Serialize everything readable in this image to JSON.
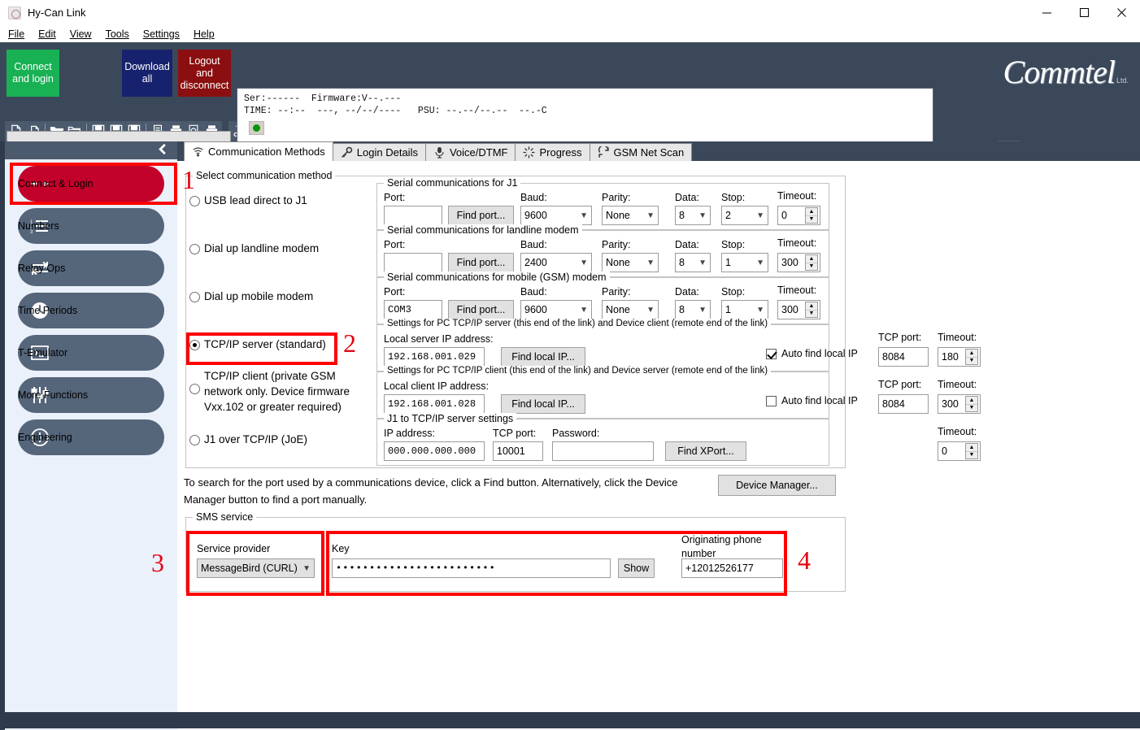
{
  "window": {
    "title": "Hy-Can Link",
    "minimize": "—",
    "maximize": "□",
    "close": "✕"
  },
  "menu": [
    {
      "label": "File"
    },
    {
      "label": "Edit"
    },
    {
      "label": "View"
    },
    {
      "label": "Tools"
    },
    {
      "label": "Settings"
    },
    {
      "label": "Help"
    }
  ],
  "header": {
    "connect_button": "Connect and login",
    "download_button": "Download all",
    "logout_button": "Logout and disconnect",
    "status_line1": "Ser:------  Firmware:V--.---",
    "status_line2": "TIME: --:--  ---, --/--/----   PSU: --.--/--.--  --.-C",
    "led_state": "green",
    "logo_text": "Commtel",
    "logo_sub": "Ltd.",
    "social": [
      "apple-icon",
      "android-icon",
      "facebook-icon",
      "youtube-icon"
    ]
  },
  "toolbar": {
    "groups": [
      [
        "new-file-icon",
        "copy-file-icon",
        "sep",
        "open-folder-icon",
        "open-folder-alt-icon",
        "sep",
        "save-icon",
        "save-as-icon",
        "save-all-icon",
        "sep",
        "document-icon",
        "print-preview-icon",
        "find-document-icon",
        "print-icon"
      ],
      [
        "cut-icon",
        "copy-icon",
        "paste-icon",
        "sep",
        "zoom-icon"
      ],
      [
        "wifi-icon",
        "key-icon",
        "microphone-icon",
        "progress-icon",
        "refresh-icon",
        "edit-pen-icon",
        "sep",
        "monitor-icon",
        "monitor-back-icon",
        "sep",
        "network-icon",
        "sep",
        "clock-icon",
        "calendar-icon",
        "download-icon",
        "sep",
        "terminal-icon",
        "sep",
        "relay-icon",
        "sliders-icon",
        "sep",
        "list-icon",
        "record-icon",
        "filter-icon",
        "speaker-icon",
        "lightning-icon",
        "card-icon",
        "chart-icon"
      ]
    ]
  },
  "sidebar": {
    "collapse_icon": "chevron-left-icon",
    "items": [
      {
        "label": "Connect & Login",
        "icon": "connect-arrows-icon",
        "active": true
      },
      {
        "label": "Numbers",
        "icon": "numbered-list-icon",
        "active": false
      },
      {
        "label": "Relay Ops",
        "icon": "relay-arrows-icon",
        "active": false
      },
      {
        "label": "Time Periods",
        "icon": "clock-icon",
        "active": false
      },
      {
        "label": "T-Emulator",
        "icon": "terminal-icon",
        "active": false
      },
      {
        "label": "More Functions",
        "icon": "sliders-icon",
        "active": false
      },
      {
        "label": "Engineering",
        "icon": "exclamation-circle-icon",
        "active": false
      }
    ]
  },
  "tabs": [
    {
      "label": "Communication Methods",
      "icon": "wifi-icon",
      "active": true
    },
    {
      "label": "Login Details",
      "icon": "key-icon",
      "active": false
    },
    {
      "label": "Voice/DTMF",
      "icon": "microphone-icon",
      "active": false
    },
    {
      "label": "Progress",
      "icon": "progress-icon",
      "active": false
    },
    {
      "label": "GSM Net Scan",
      "icon": "refresh-icon",
      "active": false
    }
  ],
  "main": {
    "select_method_legend": "Select communication method",
    "methods": [
      {
        "label": "USB lead direct to J1",
        "checked": false
      },
      {
        "label": "Dial up landline modem",
        "checked": false
      },
      {
        "label": "Dial up mobile modem",
        "checked": false
      },
      {
        "label": "TCP/IP server (standard)",
        "checked": true
      },
      {
        "label": "TCP/IP client (private GSM network only. Device firmware Vxx.102 or greater required)",
        "checked": false
      },
      {
        "label": "J1 over TCP/IP (JoE)",
        "checked": false
      }
    ],
    "serial_groups": [
      {
        "legend": "Serial communications for J1",
        "port_label": "Port:",
        "port_value": "",
        "find_button": "Find port...",
        "baud_label": "Baud:",
        "baud_value": "9600",
        "parity_label": "Parity:",
        "parity_value": "None",
        "data_label": "Data:",
        "data_value": "8",
        "stop_label": "Stop:",
        "stop_value": "2",
        "timeout_label": "Timeout:",
        "timeout_value": "0"
      },
      {
        "legend": "Serial communications for landline modem",
        "port_label": "Port:",
        "port_value": "",
        "find_button": "Find port...",
        "baud_label": "Baud:",
        "baud_value": "2400",
        "parity_label": "Parity:",
        "parity_value": "None",
        "data_label": "Data:",
        "data_value": "8",
        "stop_label": "Stop:",
        "stop_value": "1",
        "timeout_label": "Timeout:",
        "timeout_value": "300"
      },
      {
        "legend": "Serial communications for mobile (GSM) modem",
        "port_label": "Port:",
        "port_value": "COM3",
        "find_button": "Find port...",
        "baud_label": "Baud:",
        "baud_value": "9600",
        "parity_label": "Parity:",
        "parity_value": "None",
        "data_label": "Data:",
        "data_value": "8",
        "stop_label": "Stop:",
        "stop_value": "1",
        "timeout_label": "Timeout:",
        "timeout_value": "300"
      }
    ],
    "tcp_server": {
      "legend": "Settings for PC TCP/IP server (this end of the link) and Device client (remote end of the link)",
      "ip_label": "Local server IP address:",
      "ip_value": "192.168.001.029",
      "find_button": "Find local IP...",
      "auto_label": "Auto find local IP",
      "auto_checked": true,
      "port_label": "TCP port:",
      "port_value": "8084",
      "timeout_label": "Timeout:",
      "timeout_value": "180"
    },
    "tcp_client": {
      "legend": "Settings for PC TCP/IP client (this end of the link) and Device server (remote end of the link)",
      "ip_label": "Local client IP address:",
      "ip_value": "192.168.001.028",
      "find_button": "Find local IP...",
      "auto_label": "Auto find local IP",
      "auto_checked": false,
      "port_label": "TCP port:",
      "port_value": "8084",
      "timeout_label": "Timeout:",
      "timeout_value": "300"
    },
    "joe": {
      "legend": "J1 to TCP/IP server settings",
      "ip_label": "IP address:",
      "ip_value": "000.000.000.000",
      "port_label": "TCP port:",
      "port_value": "10001",
      "password_label": "Password:",
      "password_value": "",
      "find_button": "Find XPort...",
      "timeout_label": "Timeout:",
      "timeout_value": "0"
    },
    "help_text": "To search for the port used by a communications device, click a Find button. Alternatively, click the Device Manager button to find a port manually.",
    "device_manager_button": "Device Manager...",
    "sms": {
      "legend": "SMS service",
      "provider_label": "Service provider",
      "provider_value": "MessageBird (CURL)",
      "key_label": "Key",
      "key_value": "••••••••••••••••••••••••",
      "show_button": "Show",
      "phone_label": "Originating phone number",
      "phone_value": "+12012526177"
    },
    "annotations": [
      "1",
      "2",
      "3",
      "4"
    ]
  },
  "colors": {
    "accent_red": "#e30613",
    "header_dark": "#3b4859",
    "sidebar_bg": "#eaf1fa",
    "connect_green": "#18b154",
    "download_blue": "#17226e",
    "logout_red": "#8b0f10",
    "active_item": "#c2022a"
  }
}
